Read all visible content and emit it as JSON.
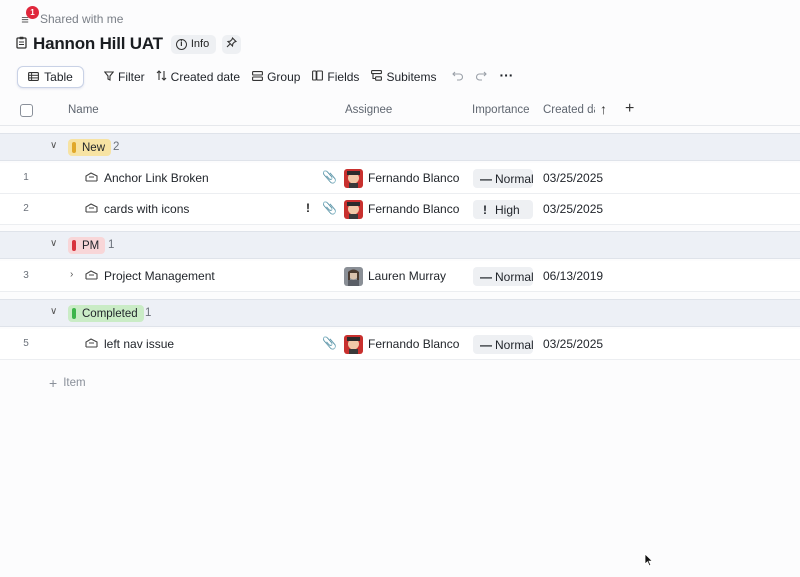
{
  "topbar": {
    "badge_count": "1",
    "breadcrumb": "Shared with me"
  },
  "title": {
    "text": "Hannon Hill UAT",
    "info_label": "Info"
  },
  "toolbar": {
    "view_label": "Table",
    "filter_label": "Filter",
    "sort_label": "Created date",
    "group_label": "Group",
    "fields_label": "Fields",
    "subitems_label": "Subitems"
  },
  "columns": {
    "name": "Name",
    "assignee": "Assignee",
    "importance": "Importance",
    "created": "Created da"
  },
  "groups": [
    {
      "label": "New",
      "count": "2",
      "color": "#f2d57a",
      "bar": "#e5a51a",
      "rows": [
        {
          "num": "1",
          "name": "Anchor Link Broken",
          "assignee": "Fernando Blanco",
          "importance": "Normal",
          "imp_sym": "—",
          "date": "03/25/2025"
        },
        {
          "num": "2",
          "name": "cards with icons",
          "assignee": "Fernando Blanco",
          "importance": "High",
          "imp_sym": "!",
          "date": "03/25/2025"
        }
      ]
    },
    {
      "label": "PM",
      "count": "1",
      "color": "#f7d3d3",
      "bar": "#d8323c",
      "rows": [
        {
          "num": "3",
          "name": "Project Management",
          "assignee": "Lauren Murray",
          "importance": "Normal",
          "imp_sym": "—",
          "date": "06/13/2019"
        }
      ]
    },
    {
      "label": "Completed",
      "count": "1",
      "color": "#c9ecc4",
      "bar": "#3db54a",
      "rows": [
        {
          "num": "5",
          "name": "left nav issue",
          "assignee": "Fernando Blanco",
          "importance": "Normal",
          "imp_sym": "—",
          "date": "03/25/2025"
        }
      ]
    }
  ],
  "add_item_label": "Item"
}
